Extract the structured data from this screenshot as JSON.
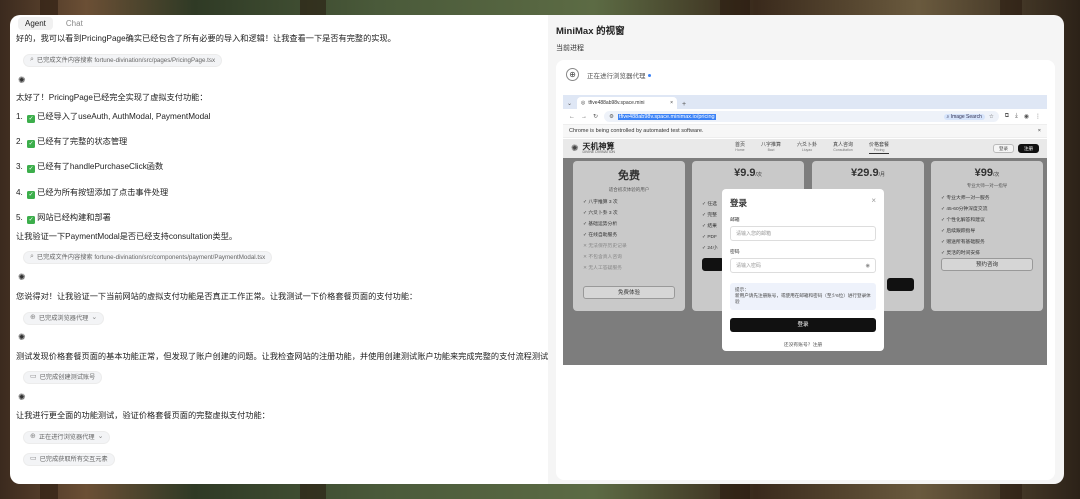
{
  "tabs": [
    {
      "label": "Agent",
      "active": true
    },
    {
      "label": "Chat",
      "active": false
    }
  ],
  "chat": {
    "l1": "好的，我可以看到PricingPage确实已经包含了所有必要的导入和逻辑！让我查看一下是否有完整的实现。",
    "chip1": "已完成文件内容搜索 fortune-divination/src/pages/PricingPage.tsx",
    "l2": "太好了！PricingPage已经完全实现了虚拟支付功能：",
    "li1": "已经导入了useAuth, AuthModal, PaymentModal",
    "li2": "已经有了完整的状态管理",
    "li3": "已经有了handlePurchaseClick函数",
    "li4": "已经为所有按钮添加了点击事件处理",
    "li5": "网站已经构建和部署",
    "n1": "1.",
    "n2": "2.",
    "n3": "3.",
    "n4": "4.",
    "n5": "5.",
    "l3": "让我验证一下PaymentModal是否已经支持consultation类型。",
    "chip2": "已完成文件内容搜索 fortune-divination/src/components/payment/PaymentModal.tsx",
    "l4": "您说得对！让我验证一下当前网站的虚拟支付功能是否真正工作正常。让我测试一下价格套餐页面的支付功能：",
    "chip3": "已完成浏览器代理",
    "l5": "测试发现价格套餐页面的基本功能正常，但发现了账户创建的问题。让我检查网站的注册功能，并使用创建测试账户功能来完成完整的支付流程测试：",
    "chip4": "已完成创建测试账号",
    "l6": "让我进行更全面的功能测试，验证价格套餐页面的完整虚拟支付功能：",
    "chip5": "正在进行浏览器代理",
    "chip6": "已完成获取所有交互元素"
  },
  "right": {
    "title": "MiniMax 的视窗",
    "subtitle": "当前进程",
    "status": "正在进行浏览器代理",
    "browser": {
      "tab_title": "tfive488ab98v.space.mini",
      "url": "tfive488ab98v.space.minimax.io/pricing",
      "image_search": "Image Search",
      "infobar": "Chrome is being controlled by automated test software."
    },
    "site": {
      "brand": "天机神算",
      "brand_sub": "DIVINE DIVINATION",
      "nav": [
        {
          "label": "首页",
          "sub": "Home"
        },
        {
          "label": "八字推算",
          "sub": "Bazi"
        },
        {
          "label": "六爻卜卦",
          "sub": "Liuyao"
        },
        {
          "label": "真人咨询",
          "sub": "Consultation"
        },
        {
          "label": "价格套餐",
          "sub": "Pricing"
        }
      ],
      "login": "登录",
      "register": "注册",
      "card1": {
        "price": "免费",
        "desc": "适合初次体验的用户",
        "f1": "八字推算 3 次",
        "f2": "六爻卜卦 3 次",
        "f3": "基础运势分析",
        "f4": "在线自助服务",
        "f5": "无法保存历史记录",
        "f6": "不包含真人咨询",
        "f7": "无人工答疑服务",
        "btn": "免费体验"
      },
      "card2": {
        "price": "¥9.9",
        "unit": "/次",
        "f1": "任选",
        "f2": "完整",
        "f3": "结果",
        "f4": "PDF",
        "f5": "24小"
      },
      "card3": {
        "price": "¥29.9",
        "unit": "/月"
      },
      "card4": {
        "price": "¥99",
        "unit": "/次",
        "desc": "专业大师一对一指导",
        "f1": "专业大师一对一服务",
        "f2": "45-60分钟深度交流",
        "f3": "个性化解答和建议",
        "f4": "后续跟踪指导",
        "f5": "赠送所有基础服务",
        "f6": "灵活的时间安排",
        "btn": "预约咨询"
      }
    },
    "modal": {
      "title": "登录",
      "email_label": "邮箱",
      "email_ph": "请输入您的邮箱",
      "pw_label": "密码",
      "pw_ph": "请输入密码",
      "tip_title": "提示：",
      "tip_body": "新用户请先注册账号，或使用在邮箱和密码（至少6位）进行登录体验",
      "submit": "登录",
      "footer": "还没有账号？注册"
    }
  }
}
